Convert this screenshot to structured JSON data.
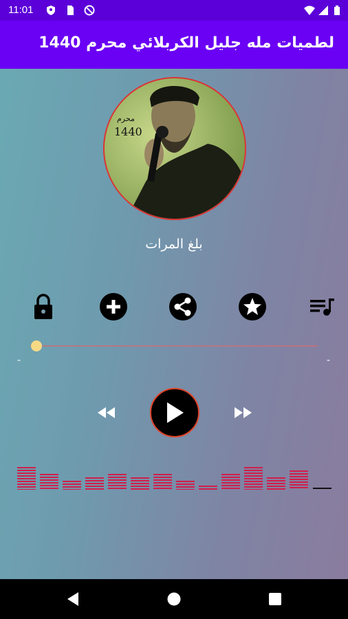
{
  "status_bar": {
    "time": "11:01",
    "icons": [
      "shield-icon",
      "sim-card-icon",
      "do-not-disturb-icon"
    ],
    "right_icons": [
      "wifi-icon",
      "signal-icon",
      "battery-icon"
    ]
  },
  "app_bar": {
    "title": "لطميات مله جليل الكربلائي محرم 1440"
  },
  "player": {
    "album_art_text": [
      "محرم",
      "1440"
    ],
    "track_name": "بلغ المرات",
    "controls": [
      "lock-icon",
      "add-icon",
      "share-icon",
      "star-icon",
      "playlist-icon"
    ],
    "progress": 0.0,
    "time_elapsed": "-",
    "time_total": "-",
    "colors": {
      "accent": "#6a00f4",
      "visualizer": "#d11e4a",
      "seek_thumb": "#f6d985",
      "play_border": "#e0442a"
    }
  },
  "visualizer": {
    "levels": [
      0.55,
      0.38,
      0.22,
      0.3,
      0.38,
      0.3,
      0.38,
      0.22,
      0.1,
      0.38,
      0.55,
      0.3,
      0.47,
      0.0
    ]
  }
}
